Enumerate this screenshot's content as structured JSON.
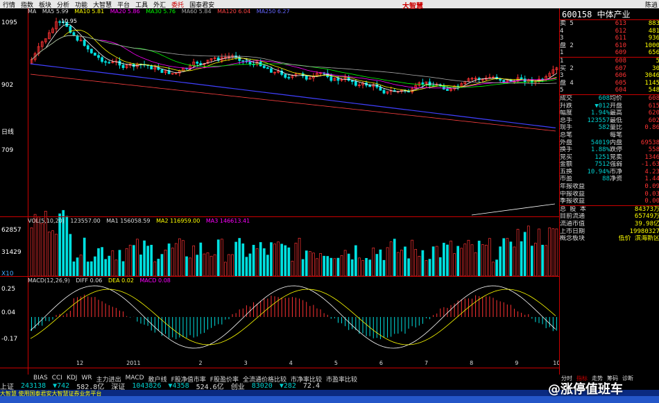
{
  "menu": [
    "行情",
    "指数",
    "板块",
    "分析",
    "功能",
    "大智慧",
    "平台",
    "工具",
    "外汇",
    "委托",
    "国泰君安"
  ],
  "brand": "大智慧",
  "window_controls": "陈逍",
  "left_axis": {
    "price_ticks": [
      "1095",
      "902",
      "709"
    ],
    "period": "日线",
    "vol_ticks": [
      "62857",
      "31429"
    ],
    "vol_unit": "X10",
    "macd_ticks": [
      "0.25",
      "0.04",
      "-0.17"
    ]
  },
  "ma_legend": {
    "label": "MA",
    "ma5": "MA5 5.99",
    "ma10": "MA10 5.81",
    "ma20": "MA20 5.86",
    "ma30": "MA30 5.76",
    "ma60": "MA60 5.84",
    "ma120": "MA120 6.04",
    "ma250": "MA250 6.27"
  },
  "high_marker": "10.95",
  "vol_legend": {
    "label": "VOL(5,10,20)",
    "val": "123557.00",
    "ma1": "MA1 156058.59",
    "ma2": "MA2 116959.00",
    "ma3": "MA3 146613.41"
  },
  "macd_legend": {
    "label": "MACD(12,26,9)",
    "diff": "DIFF 0.06",
    "dea": "DEA 0.02",
    "macd": "MACD 0.08"
  },
  "indicator_tabs": [
    "BIAS",
    "CCI",
    "KDJ",
    "WR",
    "主力进出",
    "MACD",
    "散户线",
    "F股净值市率",
    "F股盈价率",
    "全流通价格比较",
    "市净率比较",
    "市盈率比较"
  ],
  "x_labels": [
    "12",
    "2011",
    "2",
    "3",
    "4",
    "5",
    "6",
    "7",
    "8",
    "9",
    "10"
  ],
  "stock": {
    "code": "600158",
    "name": "中体产业"
  },
  "sell_orders": [
    {
      "label": "卖 5",
      "price": "613",
      "vol": "883"
    },
    {
      "label": "4",
      "price": "612",
      "vol": "481"
    },
    {
      "label": "3",
      "price": "611",
      "vol": "936"
    },
    {
      "label": "盘 2",
      "price": "610",
      "vol": "1000"
    },
    {
      "label": "1",
      "price": "609",
      "vol": "656"
    }
  ],
  "buy_orders": [
    {
      "label": "1",
      "price": "608",
      "vol": "5"
    },
    {
      "label": "买 2",
      "price": "607",
      "vol": "30"
    },
    {
      "label": "3",
      "price": "606",
      "vol": "3046"
    },
    {
      "label": "盘 4",
      "price": "605",
      "vol": "1145"
    },
    {
      "label": "5",
      "price": "604",
      "vol": "548"
    }
  ],
  "quote": [
    {
      "k1": "成交",
      "v1": "608",
      "k2": "均价",
      "v2": "608"
    },
    {
      "k1": "升跌",
      "v1": "▼012",
      "k2": "开盘",
      "v2": "615"
    },
    {
      "k1": "幅度",
      "v1": "1.94%",
      "k2": "最高",
      "v2": "620"
    },
    {
      "k1": "总手",
      "v1": "123557",
      "k2": "最低",
      "v2": "602"
    },
    {
      "k1": "现手",
      "v1": "582",
      "k2": "量比",
      "v2": "0.86"
    },
    {
      "k1": "总笔",
      "v1": "",
      "k2": "每笔",
      "v2": ""
    },
    {
      "k1": "外盘",
      "v1": "54019",
      "k2": "内盘",
      "v2": "69538"
    },
    {
      "k1": "换手",
      "v1": "1.88%",
      "k2": "跌停",
      "v2": "558"
    },
    {
      "k1": "竞买",
      "v1": "1251",
      "k2": "竞卖",
      "v2": "1346"
    },
    {
      "k1": "金额",
      "v1": "7512",
      "k2": "强弱",
      "v2": "-1.63"
    },
    {
      "k1": "五换",
      "v1": "10.94%",
      "k2": "市净",
      "v2": "4.23"
    },
    {
      "k1": "市盈",
      "v1": "88",
      "k2": "净资",
      "v2": "1.44"
    },
    {
      "k1": "年报收益",
      "v1": "",
      "k2": "",
      "v2": "0.09"
    },
    {
      "k1": "中报收益",
      "v1": "",
      "k2": "",
      "v2": "0.03"
    },
    {
      "k1": "季报收益(1)",
      "v1": "",
      "k2": "",
      "v2": "0.00"
    }
  ],
  "fundamentals": [
    {
      "k": "总  股  本",
      "v": "84373万"
    },
    {
      "k": "目前流通",
      "v": "65749万"
    },
    {
      "k": "流通市值",
      "v": "39.98亿"
    },
    {
      "k": "上市日期",
      "v": "19980327"
    },
    {
      "k": "概念板块",
      "v": "低价 滨海新区"
    }
  ],
  "right_tabs": [
    "分时",
    "指标",
    "走势",
    "筹码",
    "诊断"
  ],
  "status": {
    "sh_label": "上证",
    "sh_idx": "243138",
    "sh_chg": "▼742",
    "sh_amt": "582.8亿",
    "sz_label": "深证",
    "sz_idx": "1043826",
    "sz_chg": "▼4358",
    "sz_amt": "524.6亿",
    "cy_label": "创业",
    "cy_idx": "83020",
    "cy_chg": "▼282",
    "cy_amt": "72.4"
  },
  "notice": "大智慧 使用国泰君安大智慧证券业务平台",
  "watermark": "@涨停值班车"
}
